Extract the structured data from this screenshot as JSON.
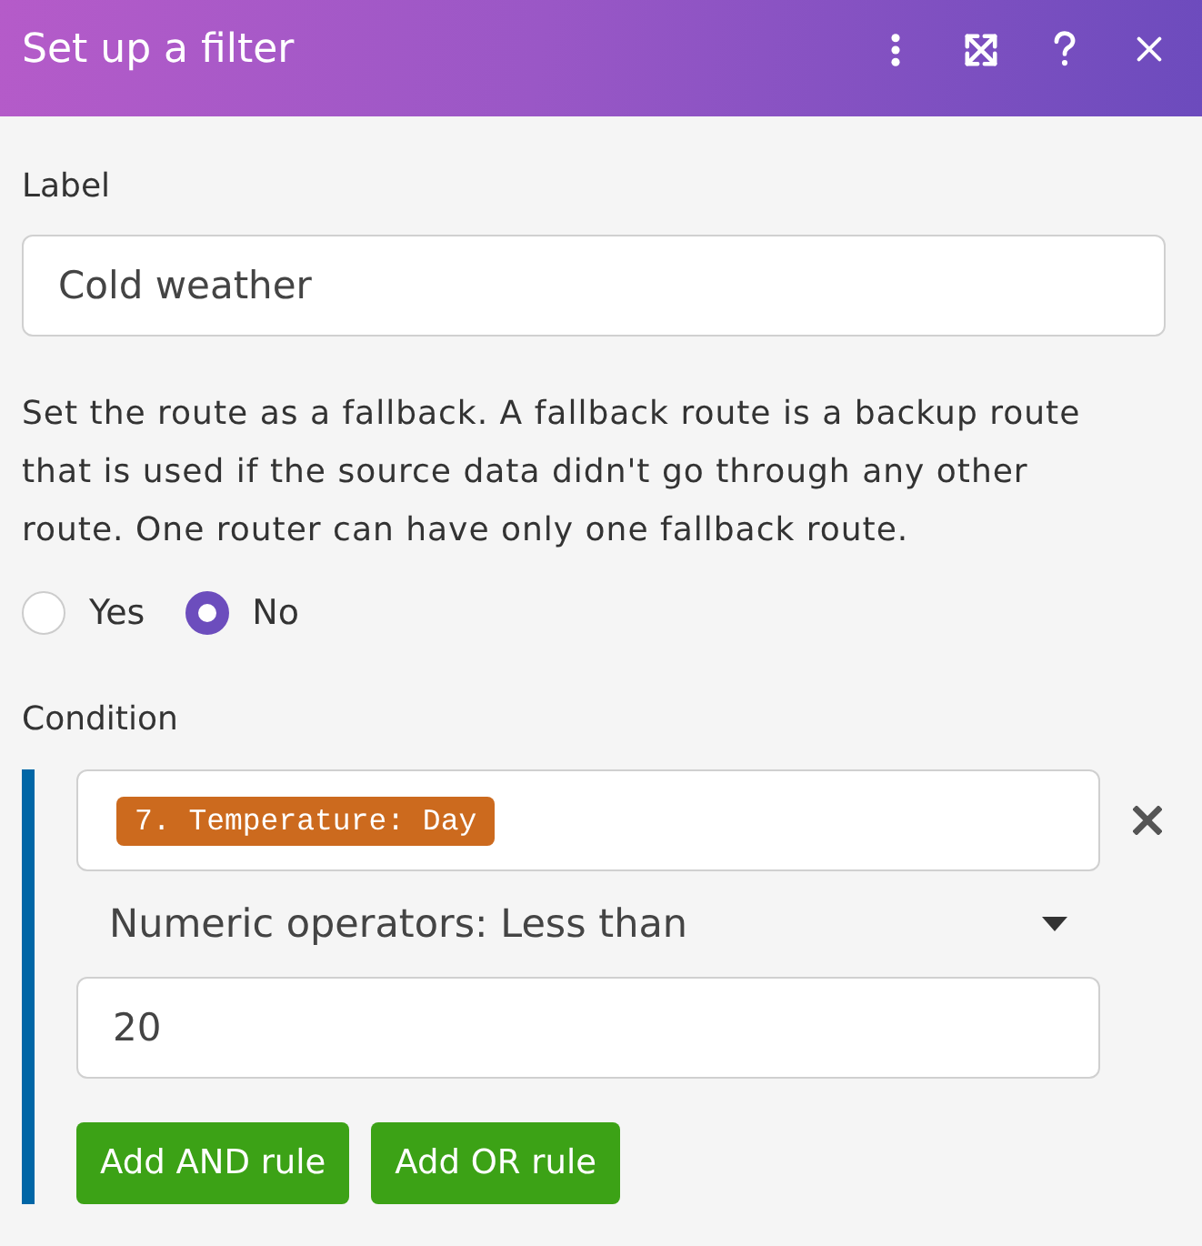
{
  "window": {
    "title": "Set up a filter"
  },
  "label_field": {
    "label": "Label",
    "value": "Cold weather"
  },
  "fallback": {
    "description": "Set the route as a fallback. A fallback route is a backup route that is used if the source data didn't go through any other route. One router can have only one fallback route.",
    "options": [
      {
        "label": "Yes",
        "selected": false
      },
      {
        "label": "No",
        "selected": true
      }
    ]
  },
  "condition": {
    "label": "Condition",
    "rules": [
      {
        "operand": {
          "kind": "variable",
          "text": "7. Temperature: Day"
        },
        "operator": "Numeric operators: Less than",
        "value": "20"
      }
    ],
    "buttons": [
      "Add AND rule",
      "Add OR rule"
    ]
  }
}
